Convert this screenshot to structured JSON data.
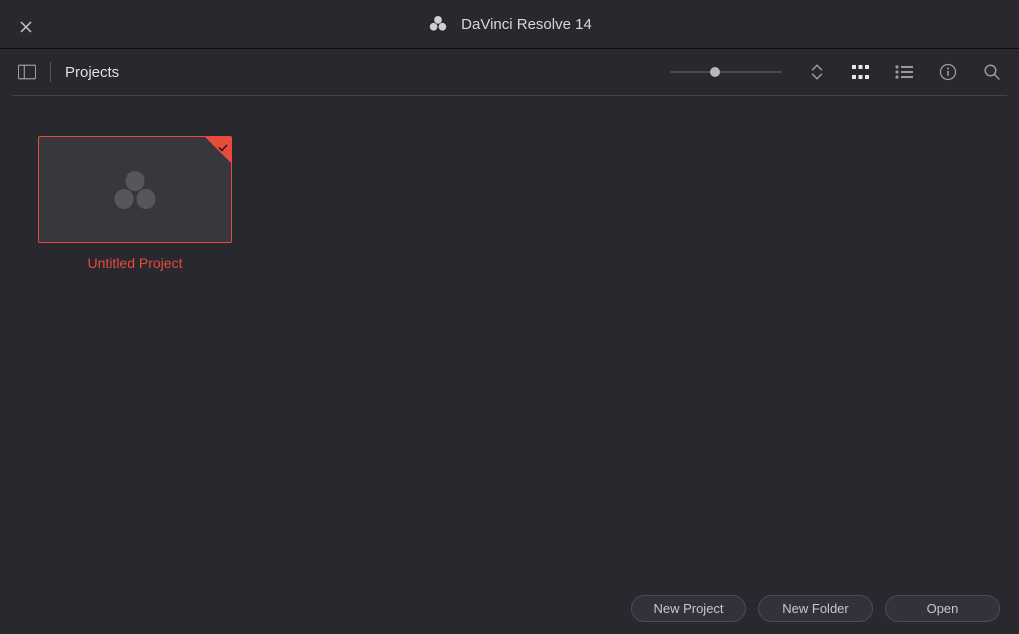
{
  "titlebar": {
    "app_title": "DaVinci Resolve 14"
  },
  "toolbar": {
    "label": "Projects",
    "slider_value": 40,
    "view_mode": "grid"
  },
  "projects": [
    {
      "name": "Untitled Project",
      "selected": true
    }
  ],
  "footer": {
    "new_project_label": "New Project",
    "new_folder_label": "New Folder",
    "open_label": "Open"
  },
  "colors": {
    "accent": "#e64b3c",
    "background": "#28282e",
    "thumb_bg": "#37373d"
  }
}
